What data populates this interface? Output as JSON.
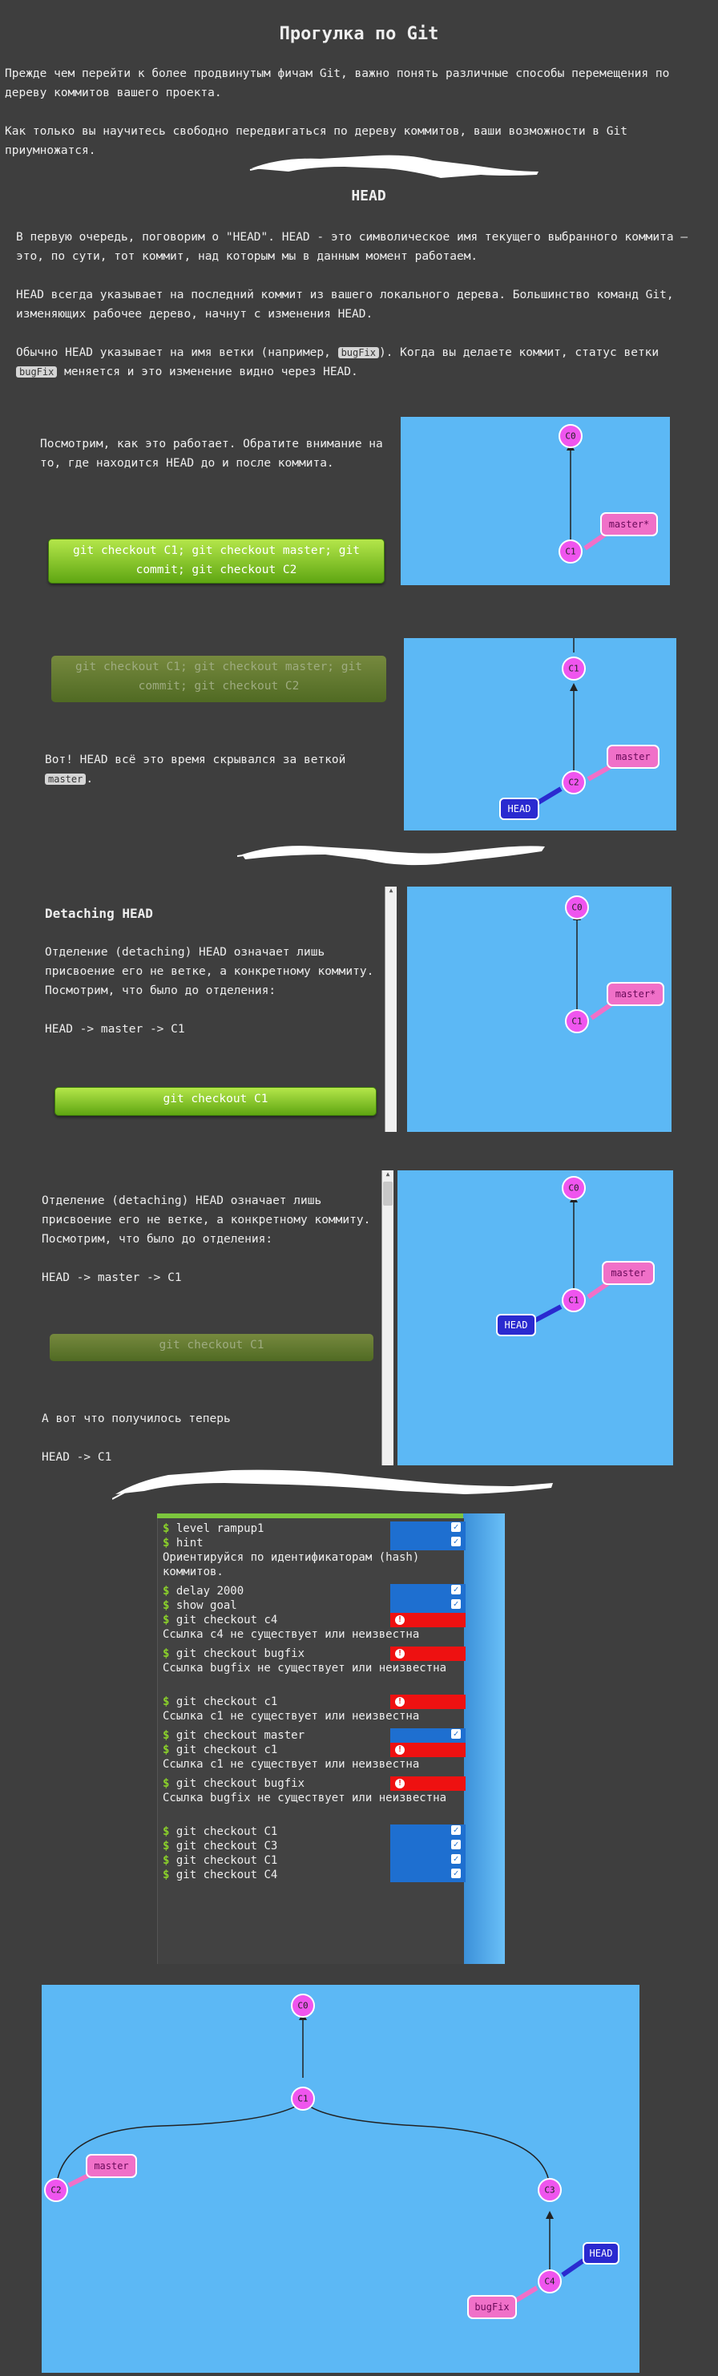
{
  "page": {
    "title": "Прогулка по Git",
    "intro1": "Прежде чем перейти к более продвинутым фичам Git, важно понять различные способы перемещения по дереву коммитов вашего проекта.",
    "intro2": "Как только вы научитесь свободно передвигаться по дереву коммитов, ваши возможности в Git приумножатся."
  },
  "head_section": {
    "heading": "HEAD",
    "p1": "В первую очередь, поговорим о \"HEAD\". HEAD - это символическое имя текущего выбранного коммита — это, по сути, тот коммит, над которым мы в данным момент работаем.",
    "p2": "HEAD всегда указывает на последний коммит из вашего локального дерева. Большинство команд Git, изменяющих рабочее дерево, начнут с изменения HEAD.",
    "p3a": "Обычно HEAD указывает на имя ветки (например,",
    "p3tag1": "bugFix",
    "p3b": "). Когда вы делаете коммит, статус ветки",
    "p3tag2": "bugFix",
    "p3c": "меняется и это изменение видно через HEAD."
  },
  "demo1": {
    "text": "Посмотрим, как это работает. Обратите внимание на то, где находится HEAD до и после коммита.",
    "button": "git checkout C1; git checkout master; git commit; git checkout C2",
    "nodes": [
      "C0",
      "C1"
    ],
    "branch": "master*"
  },
  "demo2": {
    "button": "git checkout C1; git checkout master; git commit; git checkout C2",
    "text_a": "Вот! HEAD всё это время скрывался за веткой",
    "text_tag": "master",
    "text_b": ".",
    "nodes": [
      "C1",
      "C2"
    ],
    "branch": "master",
    "head": "HEAD"
  },
  "demo3": {
    "heading": "Detaching HEAD",
    "text": "Отделение (detaching) HEAD означает лишь присвоение его не ветке, а конкретному коммиту. Посмотрим, что было до отделения:",
    "chain": "HEAD -> master -> C1",
    "button": "git checkout C1",
    "nodes": [
      "C0",
      "C1"
    ],
    "branch": "master*"
  },
  "demo4": {
    "text": "Отделение (detaching) HEAD означает лишь присвоение его не ветке, а конкретному коммиту. Посмотрим, что было до отделения:",
    "chain1": "HEAD -> master -> C1",
    "button": "git checkout C1",
    "after": "А вот что получилось теперь",
    "chain2": "HEAD -> C1",
    "nodes": [
      "C0",
      "C1"
    ],
    "branch": "master",
    "head": "HEAD"
  },
  "terminal": {
    "lines": [
      {
        "type": "cmd",
        "text": "level rampup1",
        "status": "ok"
      },
      {
        "type": "cmd",
        "text": "hint",
        "status": "ok"
      },
      {
        "type": "msg",
        "text": "Ориентируйся по идентификаторам (hash) коммитов."
      },
      {
        "type": "cmd",
        "text": "delay 2000",
        "status": "ok"
      },
      {
        "type": "cmd",
        "text": "show goal",
        "status": "ok"
      },
      {
        "type": "cmd",
        "text": "git checkout c4",
        "status": "err"
      },
      {
        "type": "msg",
        "text": "Ссылка c4 не существует или неизвестна"
      },
      {
        "type": "cmd",
        "text": "git checkout bugfix",
        "status": "err"
      },
      {
        "type": "msg",
        "text": "Ссылка bugfix не существует или неизвестна"
      },
      {
        "type": "cmd",
        "text": "git checkout c1",
        "status": "err"
      },
      {
        "type": "msg",
        "text": "Ссылка c1 не существует или неизвестна"
      },
      {
        "type": "cmd",
        "text": "git checkout master",
        "status": "ok"
      },
      {
        "type": "cmd",
        "text": "git checkout c1",
        "status": "err"
      },
      {
        "type": "msg",
        "text": "Ссылка c1 не существует или неизвестна"
      },
      {
        "type": "cmd",
        "text": "git checkout bugfix",
        "status": "err"
      },
      {
        "type": "msg",
        "text": "Ссылка bugfix не существует или неизвестна"
      },
      {
        "type": "cmd",
        "text": "git checkout C1",
        "status": "ok"
      },
      {
        "type": "cmd",
        "text": "git checkout C3",
        "status": "ok"
      },
      {
        "type": "cmd",
        "text": "git checkout C1",
        "status": "ok"
      },
      {
        "type": "cmd",
        "text": "git checkout C4",
        "status": "ok"
      }
    ],
    "prompt": "$"
  },
  "big_graph": {
    "nodes": [
      "C0",
      "C1",
      "C2",
      "C3",
      "C4"
    ],
    "branches": [
      "master",
      "bugFix"
    ],
    "head": "HEAD"
  },
  "colors": {
    "background": "#3e3e3e",
    "panel": "#5cb8f5",
    "commit": "#ef55ee",
    "branch_label": "#f070c8",
    "head_label": "#2a2ad0",
    "ok": "#1e6fd0",
    "err": "#ee1111",
    "button": "#8bc832"
  }
}
